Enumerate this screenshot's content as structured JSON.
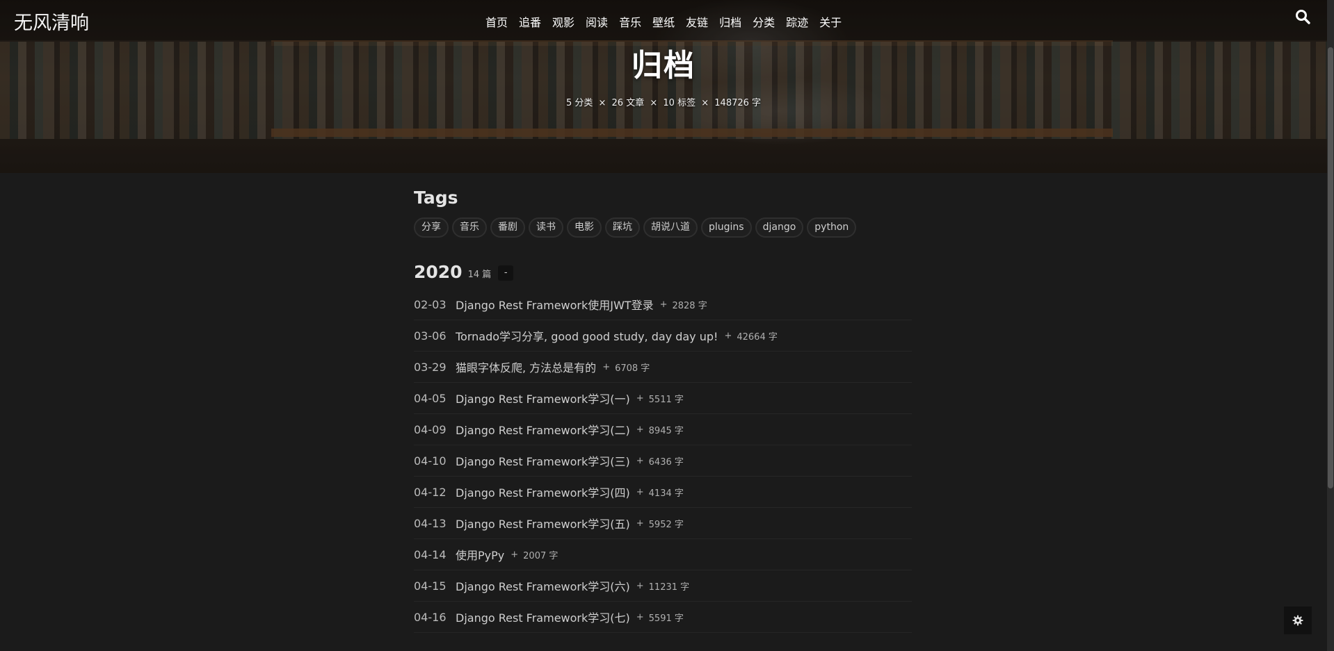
{
  "brand": "无风清响",
  "nav": [
    "首页",
    "追番",
    "观影",
    "阅读",
    "音乐",
    "壁纸",
    "友链",
    "归档",
    "分类",
    "踪迹",
    "关于"
  ],
  "hero": {
    "title": "归档",
    "stats": {
      "categories": "5 分类",
      "articles": "26 文章",
      "tags": "10 标签",
      "words": "148726 字",
      "separator": "×"
    }
  },
  "tags_section": {
    "heading": "Tags",
    "tags": [
      "分享",
      "音乐",
      "番剧",
      "读书",
      "电影",
      "踩坑",
      "胡说八道",
      "plugins",
      "django",
      "python"
    ]
  },
  "year_group": {
    "year": "2020",
    "count": "14 篇",
    "collapse_label": "-",
    "posts": [
      {
        "date": "02-03",
        "title": "Django Rest Framework使用JWT登录",
        "plus": "+",
        "words": "2828 字"
      },
      {
        "date": "03-06",
        "title": "Tornado学习分享, good good study, day day up!",
        "plus": "+",
        "words": "42664 字"
      },
      {
        "date": "03-29",
        "title": "猫眼字体反爬, 方法总是有的",
        "plus": "+",
        "words": "6708 字"
      },
      {
        "date": "04-05",
        "title": "Django Rest Framework学习(一)",
        "plus": "+",
        "words": "5511 字"
      },
      {
        "date": "04-09",
        "title": "Django Rest Framework学习(二)",
        "plus": "+",
        "words": "8945 字"
      },
      {
        "date": "04-10",
        "title": "Django Rest Framework学习(三)",
        "plus": "+",
        "words": "6436 字"
      },
      {
        "date": "04-12",
        "title": "Django Rest Framework学习(四)",
        "plus": "+",
        "words": "4134 字"
      },
      {
        "date": "04-13",
        "title": "Django Rest Framework学习(五)",
        "plus": "+",
        "words": "5952 字"
      },
      {
        "date": "04-14",
        "title": "使用PyPy",
        "plus": "+",
        "words": "2007 字"
      },
      {
        "date": "04-15",
        "title": "Django Rest Framework学习(六)",
        "plus": "+",
        "words": "11231 字"
      },
      {
        "date": "04-16",
        "title": "Django Rest Framework学习(七)",
        "plus": "+",
        "words": "5591 字"
      }
    ]
  },
  "icons": {
    "search": "search-icon",
    "settings": "gear-icon"
  }
}
